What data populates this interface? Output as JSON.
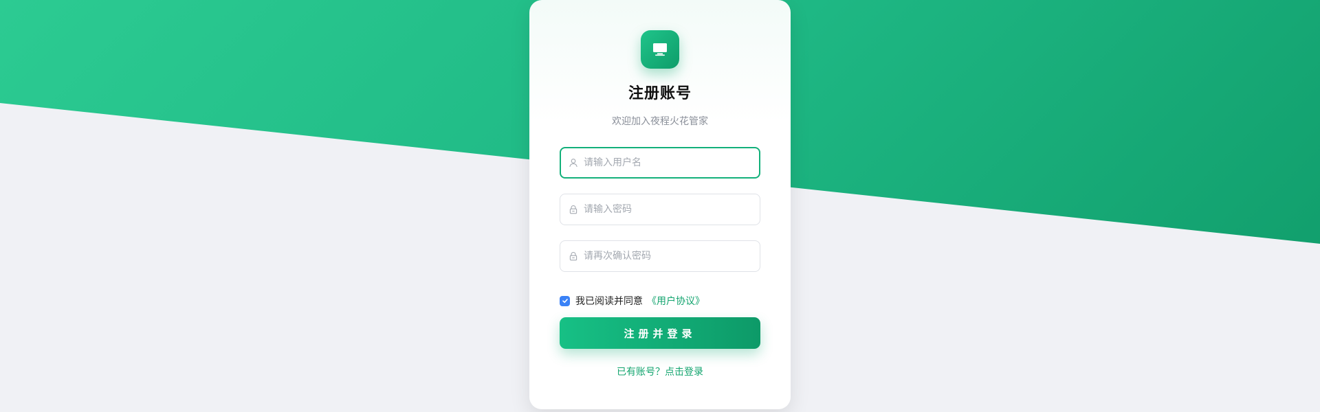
{
  "register": {
    "title": "注册账号",
    "subtitle": "欢迎加入夜程火花管家",
    "username_placeholder": "请输入用户名",
    "password_placeholder": "请输入密码",
    "confirm_placeholder": "请再次确认密码",
    "agree_text": "我已阅读并同意",
    "agreement_link": "《用户协议》",
    "submit_label": "注册并登录",
    "login_link": "已有账号？点击登录"
  },
  "state": {
    "agreement_checked": true,
    "focused_field": "username"
  },
  "icons": {
    "logo": "monitor-icon",
    "username": "user-icon",
    "password": "lock-icon",
    "confirm": "lock-icon",
    "checkbox": "check-icon"
  },
  "colors": {
    "brand": "#12b07a",
    "brand_dark": "#0d9a68",
    "checkbox": "#3b82f6",
    "page_bg": "#f0f1f5"
  }
}
